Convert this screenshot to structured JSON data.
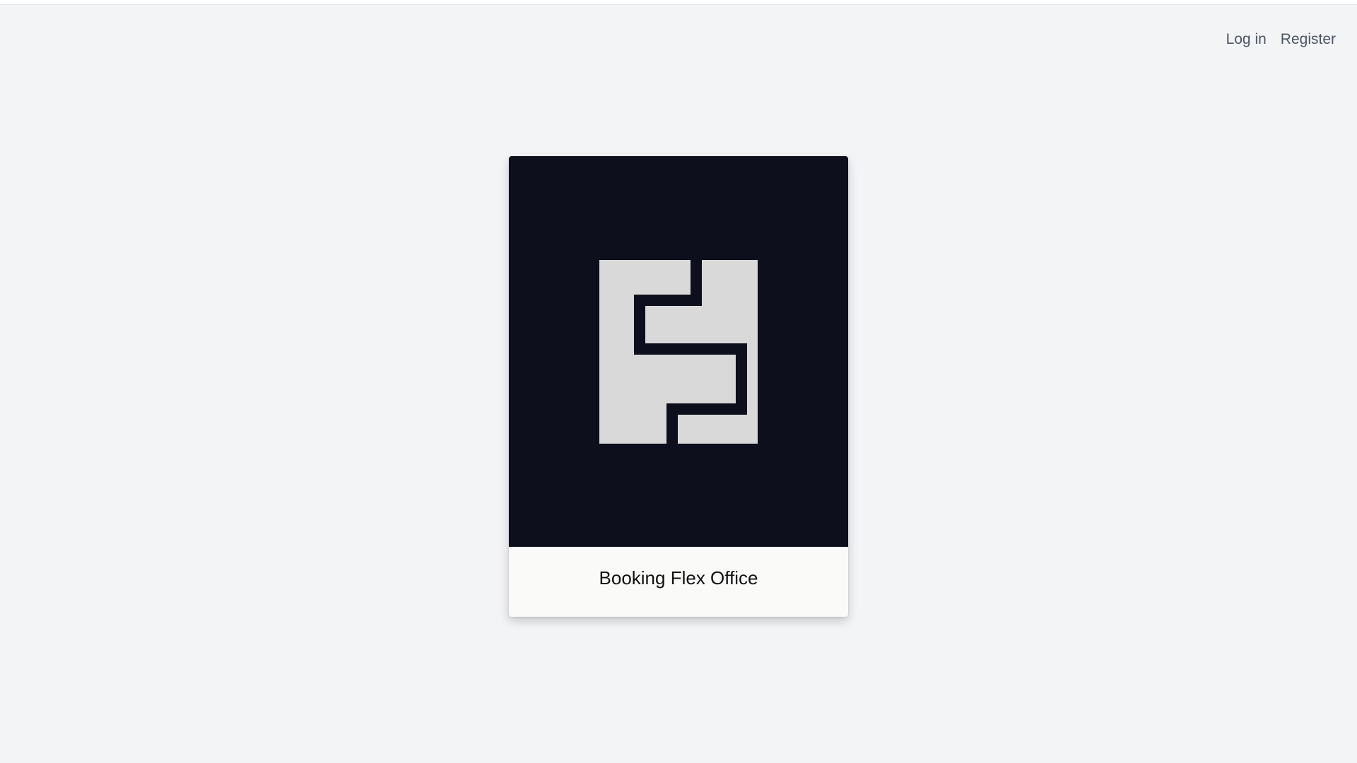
{
  "nav": {
    "login_label": "Log in",
    "register_label": "Register"
  },
  "card": {
    "title": "Booking Flex Office",
    "logo_icon": "flex-office-logo-icon"
  },
  "colors": {
    "background": "#f3f4f6",
    "card_image_background": "#0d0f1c",
    "logo_fill": "#d9d9d9",
    "card_footer_background": "#fafaf9",
    "nav_text": "#4b5563"
  }
}
